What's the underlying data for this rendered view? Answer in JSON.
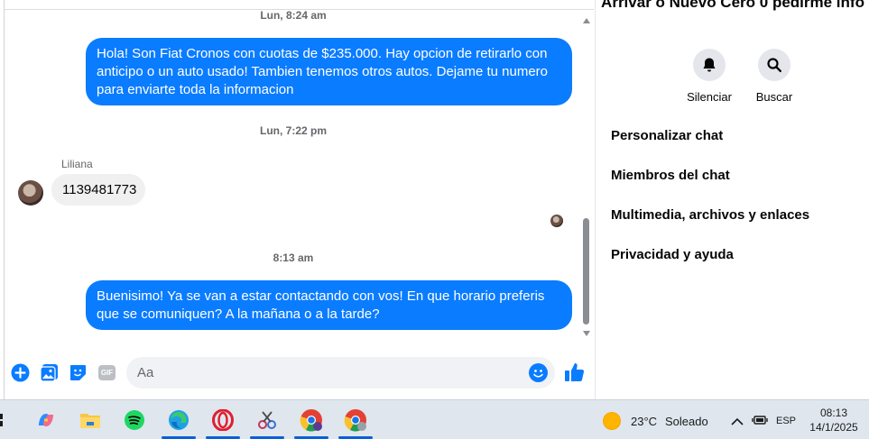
{
  "chat": {
    "timestamp_1": "Lun, 8:24 am",
    "msg_out_1": "Hola! Son Fiat Cronos con cuotas de $235.000. Hay opcion de retirarlo con anticipo o un auto usado! Tambien tenemos otros autos. Dejame tu numero para enviarte toda la informacion",
    "timestamp_2": "Lun, 7:22 pm",
    "sender_name": "Liliana",
    "msg_in_1": "1139481773",
    "timestamp_3": "8:13 am",
    "msg_out_2": "Buenisimo! Ya se van a estar contactando con vos! En que horario preferis que se comuniquen? A la mañana o a la tarde?"
  },
  "composer": {
    "placeholder": "Aa",
    "gif_label": "GIF"
  },
  "panel": {
    "title": "Arrivar o Nuevo Cero 0 pedirme info",
    "actions": [
      {
        "label": "Silenciar",
        "icon": "bell-icon"
      },
      {
        "label": "Buscar",
        "icon": "search-icon"
      }
    ],
    "rows": [
      {
        "label": "Personalizar chat"
      },
      {
        "label": "Miembros del chat"
      },
      {
        "label": "Multimedia, archivos y enlaces"
      },
      {
        "label": "Privacidad y ayuda"
      }
    ]
  },
  "taskbar": {
    "weather_temp": "23°C",
    "weather_text": "Soleado",
    "language": "ESP",
    "time": "08:13",
    "date": "14/1/2025"
  },
  "colors": {
    "messenger_blue": "#0a7cff",
    "incoming_bubble": "#f0f0f0",
    "secondary_text": "#65676b"
  }
}
